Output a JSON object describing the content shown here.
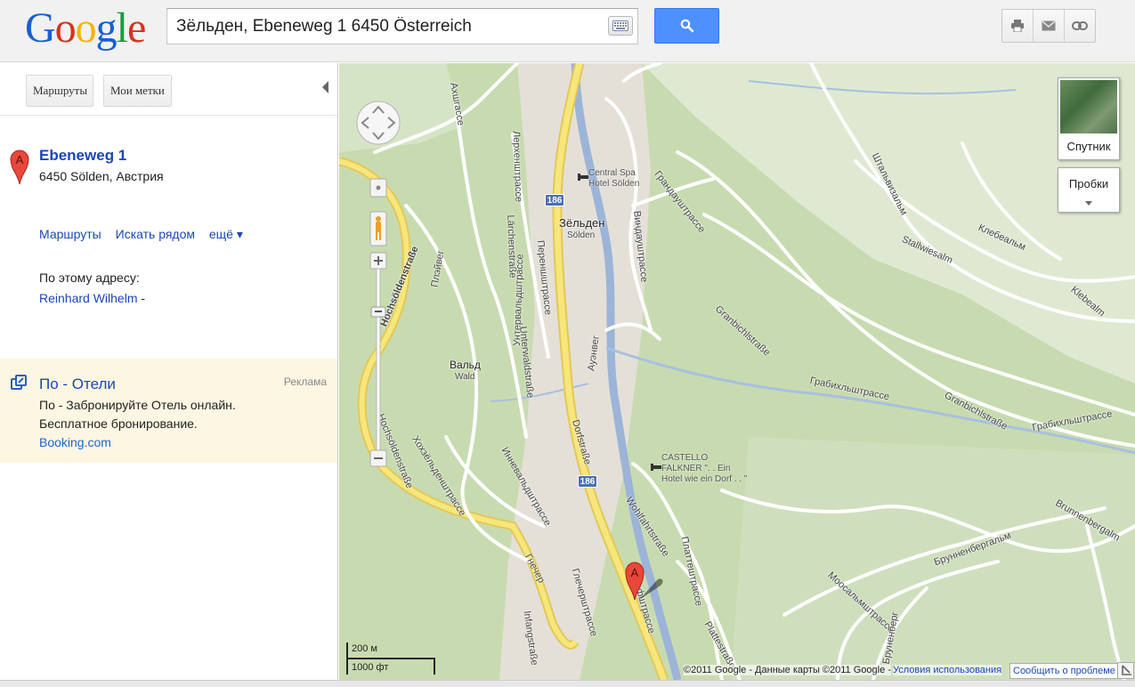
{
  "header": {
    "logo_letters": [
      {
        "ch": "G",
        "color": "#1a5fd1"
      },
      {
        "ch": "o",
        "color": "#d8321e"
      },
      {
        "ch": "o",
        "color": "#f3b40a"
      },
      {
        "ch": "g",
        "color": "#1a5fd1"
      },
      {
        "ch": "l",
        "color": "#199b3d"
      },
      {
        "ch": "e",
        "color": "#d8321e"
      }
    ],
    "search_value": "Зёльден, Ebeneweg 1 6450 Österreich",
    "tools": [
      "print-icon",
      "email-icon",
      "link-icon"
    ]
  },
  "panel": {
    "tabs": {
      "directions": "Маршруты",
      "my_places": "Мои метки"
    },
    "result": {
      "marker": "A",
      "title": "Ebeneweg 1",
      "address": "6450 Sölden, Австрия",
      "links": {
        "directions": "Маршруты",
        "search_nearby": "Искать рядом",
        "more": "ещё ▾"
      },
      "at_address_label": "По этому адресу:",
      "at_address_link": "Reinhard Wilhelm",
      "at_address_suffix": "-"
    },
    "ad": {
      "title": "По - Отели",
      "label": "Реклама",
      "line1": "По - Забронируйте Отель онлайн.",
      "line2": "Бесплатное бронирование.",
      "url": "Booking.com"
    }
  },
  "map": {
    "town": {
      "name": "Зёльден",
      "sub": "Sölden"
    },
    "village": {
      "name": "Вальд",
      "sub": "Wald"
    },
    "route_number": "186",
    "pois": {
      "spa": [
        "Central Spa",
        "Hotel Sölden"
      ],
      "castello": [
        "CASTELLO",
        "FALKNER \". . Ein",
        "Hotel wie ein Dorf . . \""
      ]
    },
    "streets": {
      "s1": "Ахшгассе",
      "s2": "Лерхенштрассе",
      "s3": "Lärchenstraße",
      "s4": "Унтервальдштрассе",
      "s5": "Unterwaldstraße",
      "s6": "Переншштрассе",
      "s7": "Плэйвег",
      "s8": "Hochsöldenstraße",
      "s9": "Хохзёльденштрассе",
      "s10": "Hochsöldenstraße",
      "s11": "Инневальдштрассе",
      "s12": "Гнечер",
      "s13": "Глечерштрассе",
      "s14": "Infangstraße",
      "s15": "Dorfstraße",
      "s16": "Дорфштрассе",
      "s17": "Ауэнвег",
      "s18": "Виндауштрассе",
      "s19": "Грандауштрассе",
      "s20": "Granbichlstraße",
      "s21": "Грабихльштрассе",
      "s22": "Granbichlstraße",
      "s23": "Грабихльштрассе",
      "s24": "Wohlfahrtstraße",
      "s25": "Платтештрассе",
      "s26": "Plattestraße",
      "s27": "Штальвизальм",
      "s28": "Stallwiesalm",
      "s29": "Клебеальм",
      "s30": "Klebealm",
      "s31": "Брунненбергальм",
      "s32": "Brunnenbergalm",
      "s33": "Моосальмштрассе",
      "s34": "Бруненберг"
    },
    "controls": {
      "satellite": "Спутник",
      "traffic": "Пробки"
    },
    "scale": {
      "metric": "200 м",
      "imperial": "1000 фт"
    },
    "copyright": "©2011 Google - Данные карты ©2011 Google -",
    "terms": "Условия использования",
    "report": "Сообщить о проблеме"
  }
}
